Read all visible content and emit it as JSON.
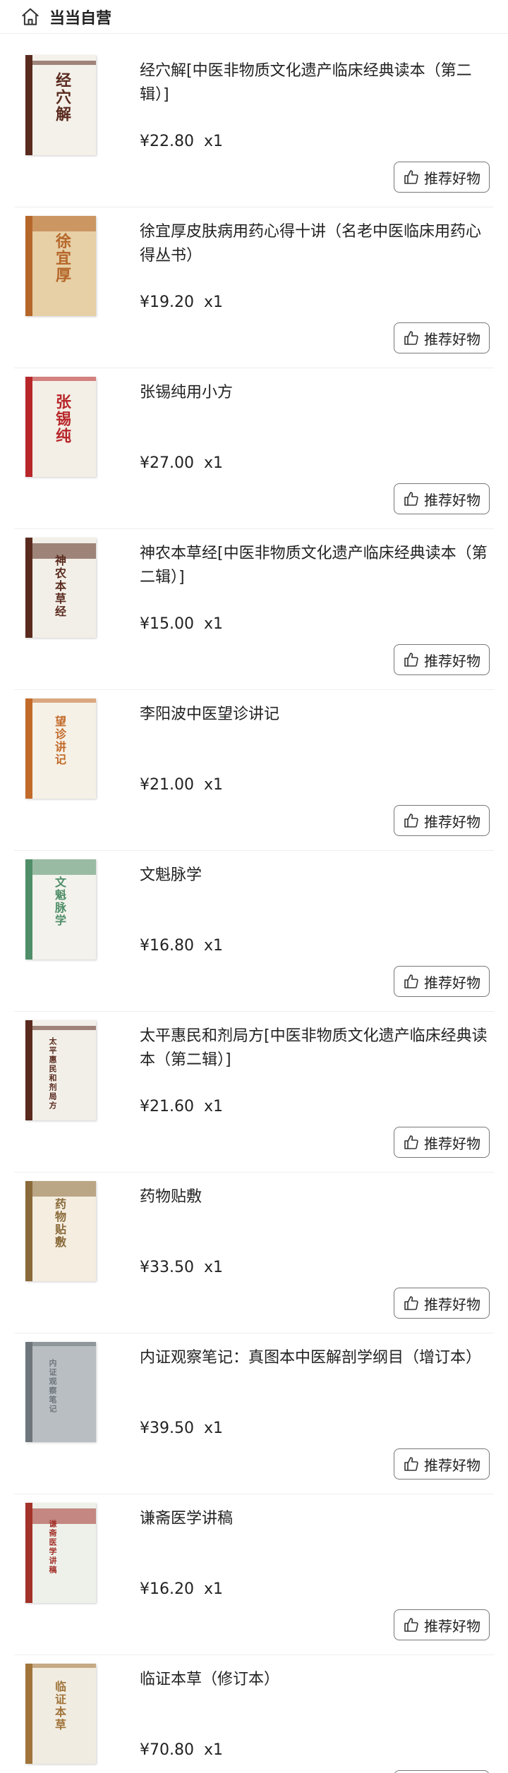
{
  "header": {
    "store_name": "当当自营",
    "icon": "home-store-icon"
  },
  "recommend_label": "推荐好物",
  "items": [
    {
      "title": "经穴解[中医非物质文化遗产临床经典读本（第二辑）]",
      "price": "¥22.80",
      "qty": "x1",
      "cover_text": "经穴解",
      "cover_bg": "#f4f1ea",
      "cover_accent": "#5a2a1e"
    },
    {
      "title": "徐宜厚皮肤病用药心得十讲（名老中医临床用药心得丛书）",
      "price": "¥19.20",
      "qty": "x1",
      "cover_text": "徐宜厚",
      "cover_bg": "#e7cfa6",
      "cover_accent": "#b5672a"
    },
    {
      "title": "张锡纯用小方",
      "price": "¥27.00",
      "qty": "x1",
      "cover_text": "张锡纯",
      "cover_bg": "#f3efe6",
      "cover_accent": "#b8262a"
    },
    {
      "title": "神农本草经[中医非物质文化遗产临床经典读本（第二辑）]",
      "price": "¥15.00",
      "qty": "x1",
      "cover_text": "神农本草经",
      "cover_bg": "#f2efe8",
      "cover_accent": "#5a2a1e"
    },
    {
      "title": "李阳波中医望诊讲记",
      "price": "¥21.00",
      "qty": "x1",
      "cover_text": "望诊讲记",
      "cover_bg": "#f6f1e6",
      "cover_accent": "#c26a2a"
    },
    {
      "title": "文魁脉学",
      "price": "¥16.80",
      "qty": "x1",
      "cover_text": "文魁脉学",
      "cover_bg": "#f3f2ec",
      "cover_accent": "#4f8e68"
    },
    {
      "title": "太平惠民和剂局方[中医非物质文化遗产临床经典读本（第二辑）]",
      "price": "¥21.60",
      "qty": "x1",
      "cover_text": "太平惠民和剂局方",
      "cover_bg": "#f2efe8",
      "cover_accent": "#5a2a1e"
    },
    {
      "title": "药物贴敷",
      "price": "¥33.50",
      "qty": "x1",
      "cover_text": "药物贴敷",
      "cover_bg": "#f4ede0",
      "cover_accent": "#8a6a3a"
    },
    {
      "title": "内证观察笔记：真图本中医解剖学纲目（增订本）",
      "price": "¥39.50",
      "qty": "x1",
      "cover_text": "内证观察笔记",
      "cover_bg": "#b9bec2",
      "cover_accent": "#6e767c"
    },
    {
      "title": "谦斋医学讲稿",
      "price": "¥16.20",
      "qty": "x1",
      "cover_text": "谦斋医学讲稿",
      "cover_bg": "#eef0ea",
      "cover_accent": "#a3322a"
    },
    {
      "title": "临证本草（修订本）",
      "price": "¥70.80",
      "qty": "x1",
      "cover_text": "临证本草",
      "cover_bg": "#f1ece2",
      "cover_accent": "#a0743a"
    }
  ]
}
